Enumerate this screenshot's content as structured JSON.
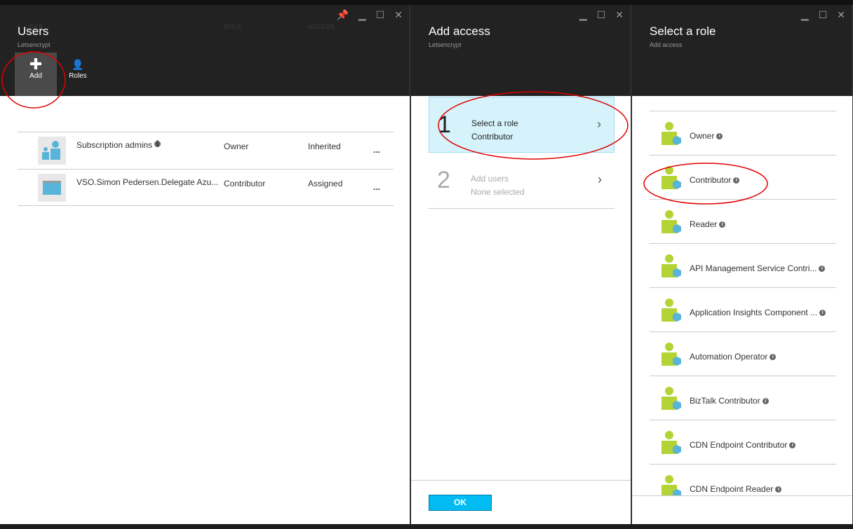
{
  "users_blade": {
    "title": "Users",
    "subtitle": "Letsencrypt",
    "commands": [
      {
        "label": "Add",
        "icon": "plus-icon"
      },
      {
        "label": "Roles",
        "icon": "roles-icon"
      }
    ],
    "columns": [
      "USER",
      "ROLE",
      "ACCESS"
    ],
    "rows": [
      {
        "user": "Subscription admins",
        "role": "Owner",
        "access": "Inherited",
        "more": "..."
      },
      {
        "user": "VSO.Simon Pedersen.Delegate Azu...",
        "role": "Contributor",
        "access": "Assigned",
        "more": "..."
      }
    ]
  },
  "add_access_blade": {
    "title": "Add access",
    "subtitle": "Letsencrypt",
    "steps": [
      {
        "number": "1",
        "label": "Select a role",
        "value": "Contributor"
      },
      {
        "number": "2",
        "label": "Add users",
        "value": "None selected"
      }
    ],
    "ok_label": "OK"
  },
  "select_role_blade": {
    "title": "Select a role",
    "subtitle": "Add access",
    "roles": [
      "Owner",
      "Contributor",
      "Reader",
      "API Management Service Contri...",
      "Application Insights Component ...",
      "Automation Operator",
      "BizTalk Contributor",
      "CDN Endpoint Contributor",
      "CDN Endpoint Reader"
    ]
  },
  "colors": {
    "accent": "#00bcf2",
    "selected_step_bg": "#d6f3fc",
    "annotation": "#e00000",
    "role_icon": "#b4d334"
  }
}
